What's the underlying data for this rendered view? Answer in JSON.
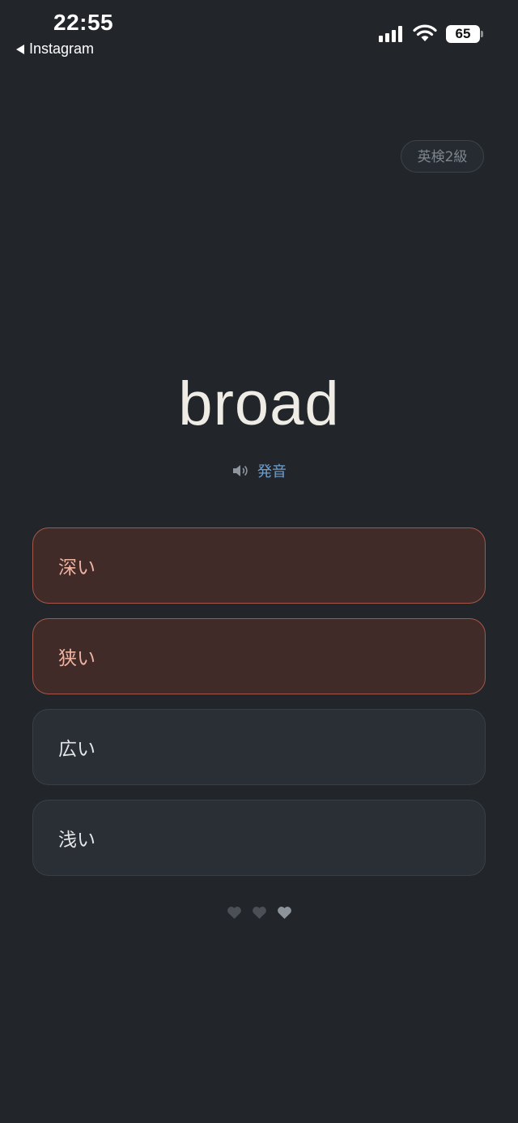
{
  "status_bar": {
    "time": "22:55",
    "back_label": "Instagram",
    "battery": "65"
  },
  "quiz": {
    "level": "英検2級",
    "word": "broad",
    "pronounce_label": "発音",
    "options": [
      {
        "label": "深い",
        "state": "wrong"
      },
      {
        "label": "狭い",
        "state": "wrong"
      },
      {
        "label": "広い",
        "state": "normal"
      },
      {
        "label": "浅い",
        "state": "normal"
      }
    ],
    "lives": {
      "total": 3,
      "remaining": 1
    }
  },
  "icons": {
    "back": "back-arrow-icon",
    "signal": "cellular-signal-icon",
    "wifi": "wifi-icon",
    "battery": "battery-icon",
    "speaker": "speaker-icon",
    "heart": "heart-icon"
  },
  "colors": {
    "background": "#22262b",
    "wrong_bg": "#402b28",
    "wrong_border": "#a4574a",
    "wrong_text": "#f0b3a1",
    "accent_blue": "#6f9fcf",
    "heart_lost": "#4b5057",
    "heart_active": "#8c939a"
  }
}
